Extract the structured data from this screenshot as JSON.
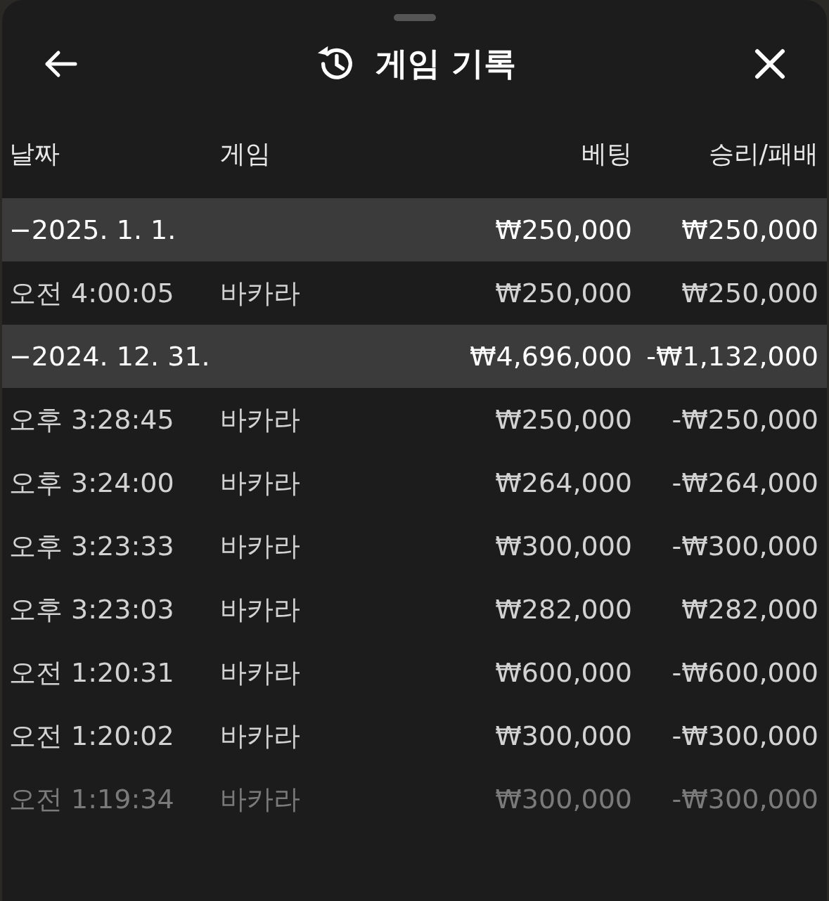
{
  "header": {
    "title": "게임 기록"
  },
  "columns": [
    "날짜",
    "게임",
    "베팅",
    "승리/패배"
  ],
  "groups": [
    {
      "date": "−2025. 1. 1.",
      "bet": "₩250,000",
      "result": "₩250,000",
      "rows": [
        {
          "time": "오전 4:00:05",
          "game": "바카라",
          "bet": "₩250,000",
          "result": "₩250,000"
        }
      ]
    },
    {
      "date": "−2024. 12. 31.",
      "bet": "₩4,696,000",
      "result": "-₩1,132,000",
      "rows": [
        {
          "time": "오후 3:28:45",
          "game": "바카라",
          "bet": "₩250,000",
          "result": "-₩250,000"
        },
        {
          "time": "오후 3:24:00",
          "game": "바카라",
          "bet": "₩264,000",
          "result": "-₩264,000"
        },
        {
          "time": "오후 3:23:33",
          "game": "바카라",
          "bet": "₩300,000",
          "result": "-₩300,000"
        },
        {
          "time": "오후 3:23:03",
          "game": "바카라",
          "bet": "₩282,000",
          "result": "₩282,000"
        },
        {
          "time": "오전 1:20:31",
          "game": "바카라",
          "bet": "₩600,000",
          "result": "-₩600,000"
        },
        {
          "time": "오전 1:20:02",
          "game": "바카라",
          "bet": "₩300,000",
          "result": "-₩300,000"
        },
        {
          "time": "오전 1:19:34",
          "game": "바카라",
          "bet": "₩300,000",
          "result": "-₩300,000"
        }
      ]
    }
  ]
}
